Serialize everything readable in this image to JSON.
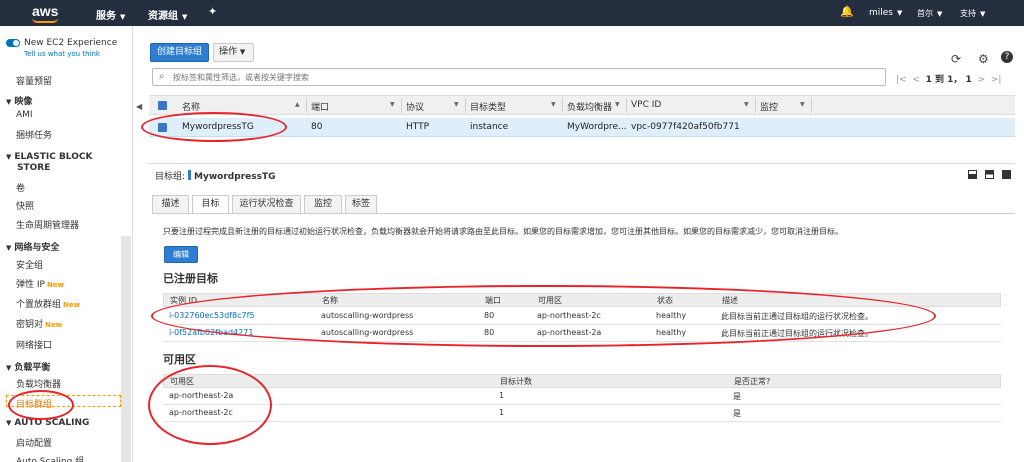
{
  "topnav": {
    "logo": "aws",
    "services": "服务",
    "resource_groups": "资源组",
    "user": "miles",
    "region": "首尔",
    "support": "支持"
  },
  "sidebar": {
    "experience_title": "New EC2 Experience",
    "experience_link": "Tell us what you think",
    "items": [
      {
        "type": "item",
        "label": "容量预留"
      },
      {
        "type": "head",
        "label": "映像"
      },
      {
        "type": "item",
        "label": "AMI"
      },
      {
        "type": "item",
        "label": "捆绑任务"
      },
      {
        "type": "head",
        "label": "ELASTIC BLOCK"
      },
      {
        "type": "head2",
        "label": "STORE"
      },
      {
        "type": "item",
        "label": "卷"
      },
      {
        "type": "item",
        "label": "快照"
      },
      {
        "type": "item",
        "label": "生命周期管理器"
      },
      {
        "type": "head",
        "label": "网络与安全"
      },
      {
        "type": "item",
        "label": "安全组"
      },
      {
        "type": "item",
        "label": "弹性 IP",
        "badge": "New"
      },
      {
        "type": "item",
        "label": "个置放群组",
        "badge": "New"
      },
      {
        "type": "item",
        "label": "密钥对",
        "badge": "New"
      },
      {
        "type": "item",
        "label": "网络接口"
      },
      {
        "type": "head",
        "label": "负载平衡"
      },
      {
        "type": "item",
        "label": "负载均衡器"
      },
      {
        "type": "active",
        "label": "目标群组"
      },
      {
        "type": "head",
        "label": "AUTO SCALING"
      },
      {
        "type": "item",
        "label": "启动配置"
      },
      {
        "type": "item",
        "label": "Auto Scaling 组"
      }
    ]
  },
  "toolbar": {
    "create_label": "创建目标组",
    "actions_label": "操作"
  },
  "search": {
    "placeholder": "按标签和属性筛选，或者按关键字搜索"
  },
  "pager": {
    "text": "1 到 1， 1"
  },
  "table": {
    "columns": [
      "名称",
      "端口",
      "协议",
      "目标类型",
      "负载均衡器",
      "VPC ID",
      "监控"
    ],
    "rows": [
      [
        "MywordpressTG",
        "80",
        "HTTP",
        "instance",
        "MyWordpre...",
        "vpc-0977f420af50fb771",
        ""
      ]
    ]
  },
  "detail": {
    "label": "目标组:",
    "name": "MywordpressTG",
    "tabs": [
      "描述",
      "目标",
      "运行状况检查",
      "监控",
      "标签"
    ],
    "active_tab": 1,
    "info": "只要注册过程完成且新注册的目标通过初始运行状况检查，负载均衡器就会开始将请求路由至此目标。如果您的目标需求增加，您可注册其他目标。如果您的目标需求减少，您可取消注册目标。",
    "edit_label": "编辑",
    "registered_title": "已注册目标",
    "registered_columns": [
      "实例 ID",
      "名称",
      "端口",
      "可用区",
      "状态",
      "描述"
    ],
    "registered_rows": [
      [
        "i-032760ec53df8c7f5",
        "autoscalling-wordpress",
        "80",
        "ap-northeast-2c",
        "healthy",
        "此目标当前正通过目标组的运行状况检查。"
      ],
      [
        "i-0f52afb02fbad4271",
        "autoscalling-wordpress",
        "80",
        "ap-northeast-2a",
        "healthy",
        "此目标当前正通过目标组的运行状况检查。"
      ]
    ],
    "az_title": "可用区",
    "az_columns": [
      "可用区",
      "目标计数",
      "是否正常?"
    ],
    "az_rows": [
      [
        "ap-northeast-2a",
        "1",
        "是"
      ],
      [
        "ap-northeast-2c",
        "1",
        "是"
      ]
    ]
  },
  "colors": {
    "nav_bg": "#232f3e",
    "primary": "#2e7dd1",
    "annotation_red": "#e8242b",
    "selected_row": "#dfeefb"
  }
}
